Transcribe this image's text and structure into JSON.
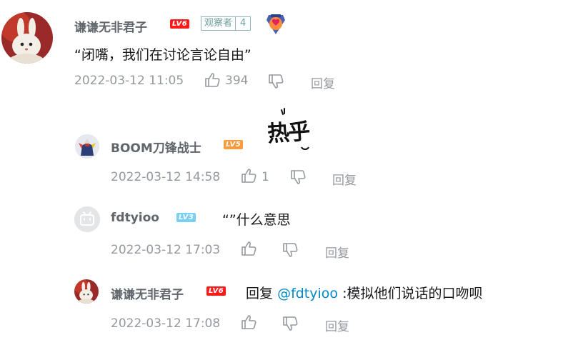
{
  "main_comment": {
    "username": "谦谦无非君子",
    "level": "LV6",
    "badge_label": "观察者",
    "badge_number": "4",
    "text": "“闭嘴，我们在讨论言论自由”",
    "timestamp": "2022-03-12 11:05",
    "like_count": "394",
    "reply_label": "回复"
  },
  "replies": [
    {
      "username": "BOOM刀锋战士",
      "level": "LV5",
      "sticker_text": "热乎",
      "timestamp": "2022-03-12 14:58",
      "like_count": "1",
      "reply_label": "回复"
    },
    {
      "username": "fdtyioo",
      "level": "LV3",
      "text": "“”什么意思",
      "timestamp": "2022-03-12 17:03",
      "reply_label": "回复"
    },
    {
      "username": "谦谦无非君子",
      "level": "LV6",
      "text_prefix": "回复",
      "mention": "@fdtyioo",
      "text_suffix": ":模拟他们说话的口吻呗",
      "timestamp": "2022-03-12 17:08",
      "reply_label": "回复"
    }
  ],
  "colors": {
    "lv6": "#ff1a1a",
    "lv5": "#ff9a3c",
    "lv3": "#7bcff4",
    "mention": "#008ac5",
    "meta": "#9499a0"
  },
  "icons": [
    "thumbs-up-icon",
    "thumbs-down-icon",
    "medal-icon",
    "bunny-avatar",
    "gundam-avatar",
    "tv-avatar"
  ]
}
